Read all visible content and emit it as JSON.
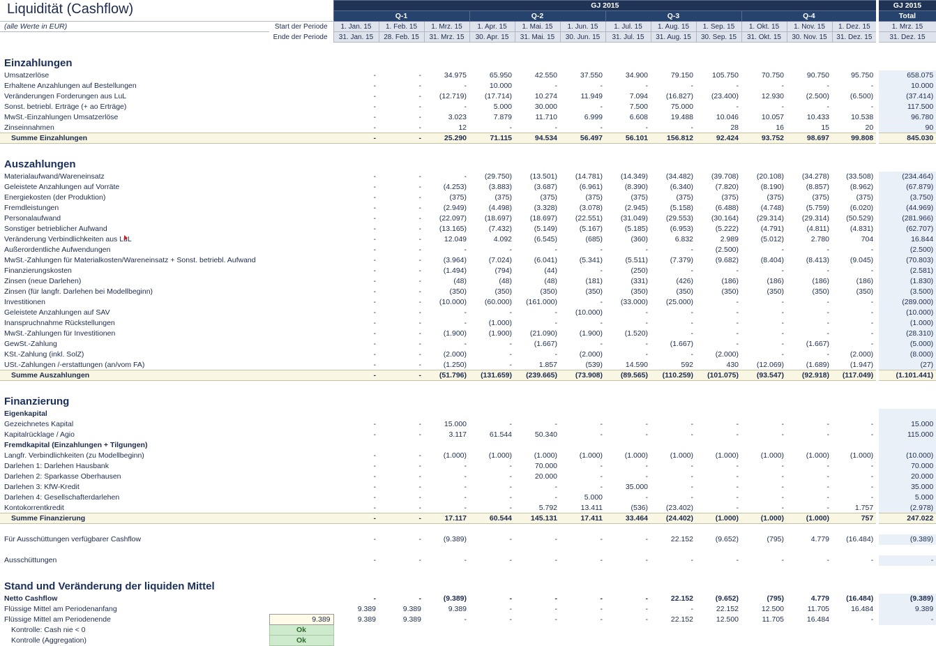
{
  "title": "Liquidität (Cashflow)",
  "subtitle": "(alle Werte in EUR)",
  "period_start_label": "Start der Periode",
  "period_end_label": "Ende der Periode",
  "header": {
    "year_main": "GJ 2015",
    "year_total": "GJ 2015",
    "total_sub": "Total",
    "quarters": [
      "Q-1",
      "Q-2",
      "Q-3",
      "Q-4"
    ],
    "months_start": [
      "1. Jan. 15",
      "1. Feb. 15",
      "1. Mrz. 15",
      "1. Apr. 15",
      "1. Mai. 15",
      "1. Jun. 15",
      "1. Jul. 15",
      "1. Aug. 15",
      "1. Sep. 15",
      "1. Okt. 15",
      "1. Nov. 15",
      "1. Dez. 15"
    ],
    "months_end": [
      "31. Jan. 15",
      "28. Feb. 15",
      "31. Mrz. 15",
      "30. Apr. 15",
      "31. Mai. 15",
      "30. Jun. 15",
      "31. Jul. 15",
      "31. Aug. 15",
      "30. Sep. 15",
      "31. Okt. 15",
      "30. Nov. 15",
      "31. Dez. 15"
    ],
    "total_start": "1. Mrz. 15",
    "total_end": "31. Dez. 15"
  },
  "sections": {
    "einz": "Einzahlungen",
    "ausz": "Auszahlungen",
    "fin": "Finanzierung",
    "stand": "Stand und Veränderung der liquiden Mittel"
  },
  "rows": {
    "umsatz": {
      "label": "Umsatzerlöse",
      "v": [
        "-",
        "-",
        "34.975",
        "65.950",
        "42.550",
        "37.550",
        "34.900",
        "79.150",
        "105.750",
        "70.750",
        "90.750",
        "95.750"
      ],
      "t": "658.075"
    },
    "anzahlungen": {
      "label": "Erhaltene Anzahlungen auf Bestellungen",
      "v": [
        "-",
        "-",
        "-",
        "10.000",
        "-",
        "-",
        "-",
        "-",
        "-",
        "-",
        "-",
        "-"
      ],
      "t": "10.000"
    },
    "fordlul": {
      "label": "Veränderungen Forderungen aus LuL",
      "v": [
        "-",
        "-",
        "(12.719)",
        "(17.714)",
        "10.274",
        "11.949",
        "7.094",
        "(16.827)",
        "(23.400)",
        "12.930",
        "(2.500)",
        "(6.500)"
      ],
      "t": "(37.414)"
    },
    "sonsterl": {
      "label": "Sonst. betriebl. Erträge (+ ao Erträge)",
      "v": [
        "-",
        "-",
        "-",
        "5.000",
        "30.000",
        "-",
        "7.500",
        "75.000",
        "-",
        "-",
        "-",
        "-"
      ],
      "t": "117.500"
    },
    "mwsteinz": {
      "label": "MwSt.-Einzahlungen Umsatzerlöse",
      "v": [
        "-",
        "-",
        "3.023",
        "7.879",
        "11.710",
        "6.999",
        "6.608",
        "19.488",
        "10.046",
        "10.057",
        "10.433",
        "10.538"
      ],
      "t": "96.780"
    },
    "zinsein": {
      "label": "Zinseinnahmen",
      "v": [
        "-",
        "-",
        "12",
        "-",
        "-",
        "-",
        "-",
        "-",
        "28",
        "16",
        "15",
        "20"
      ],
      "t": "90"
    },
    "sum_einz": {
      "label": "Summe Einzahlungen",
      "v": [
        "-",
        "-",
        "25.290",
        "71.115",
        "94.534",
        "56.497",
        "56.101",
        "156.812",
        "92.424",
        "93.752",
        "98.697",
        "99.808"
      ],
      "t": "845.030"
    },
    "material": {
      "label": "Materialaufwand/Wareneinsatz",
      "v": [
        "-",
        "-",
        "-",
        "(29.750)",
        "(13.501)",
        "(14.781)",
        "(14.349)",
        "(34.482)",
        "(39.708)",
        "(20.108)",
        "(34.278)",
        "(33.508)"
      ],
      "t": "(234.464)"
    },
    "gelanzvor": {
      "label": "Geleistete Anzahlungen auf Vorräte",
      "v": [
        "-",
        "-",
        "(4.253)",
        "(3.883)",
        "(3.687)",
        "(6.961)",
        "(8.390)",
        "(6.340)",
        "(7.820)",
        "(8.190)",
        "(8.857)",
        "(8.962)"
      ],
      "t": "(67.879)"
    },
    "energie": {
      "label": "Energiekosten (der Produktion)",
      "v": [
        "-",
        "-",
        "(375)",
        "(375)",
        "(375)",
        "(375)",
        "(375)",
        "(375)",
        "(375)",
        "(375)",
        "(375)",
        "(375)"
      ],
      "t": "(3.750)"
    },
    "fremdl": {
      "label": "Fremdleistungen",
      "v": [
        "-",
        "-",
        "(2.949)",
        "(4.498)",
        "(3.328)",
        "(3.078)",
        "(2.945)",
        "(5.158)",
        "(6.488)",
        "(4.748)",
        "(5.759)",
        "(6.020)"
      ],
      "t": "(44.969)"
    },
    "personal": {
      "label": "Personalaufwand",
      "v": [
        "-",
        "-",
        "(22.097)",
        "(18.697)",
        "(18.697)",
        "(22.551)",
        "(31.049)",
        "(29.553)",
        "(30.164)",
        "(29.314)",
        "(29.314)",
        "(50.529)"
      ],
      "t": "(281.966)"
    },
    "sonstaufw": {
      "label": "Sonstiger betrieblicher Aufwand",
      "v": [
        "-",
        "-",
        "(13.165)",
        "(7.432)",
        "(5.149)",
        "(5.167)",
        "(5.185)",
        "(6.953)",
        "(5.222)",
        "(4.791)",
        "(4.811)",
        "(4.831)"
      ],
      "t": "(62.707)"
    },
    "verblul": {
      "label": "Veränderung Verbindlichkeiten aus LuL",
      "v": [
        "-",
        "-",
        "12.049",
        "4.092",
        "(6.545)",
        "(685)",
        "(360)",
        "6.832",
        "2.989",
        "(5.012)",
        "2.780",
        "704"
      ],
      "t": "16.844"
    },
    "aoaufw": {
      "label": "Außerordentliche Aufwendungen",
      "v": [
        "-",
        "-",
        "-",
        "-",
        "-",
        "-",
        "-",
        "-",
        "(2.500)",
        "-",
        "-",
        "-"
      ],
      "t": "(2.500)"
    },
    "mwstzahl": {
      "label": "MwSt.-Zahlungen für Materialkosten/Wareneinsatz + Sonst. betriebl. Aufwand",
      "v": [
        "-",
        "-",
        "(3.964)",
        "(7.024)",
        "(6.041)",
        "(5.341)",
        "(5.511)",
        "(7.379)",
        "(9.682)",
        "(8.404)",
        "(8.413)",
        "(9.045)"
      ],
      "t": "(70.803)"
    },
    "finkost": {
      "label": "Finanzierungskosten",
      "v": [
        "-",
        "-",
        "(1.494)",
        "(794)",
        "(44)",
        "-",
        "(250)",
        "-",
        "-",
        "-",
        "-",
        "-"
      ],
      "t": "(2.581)"
    },
    "zinsneu": {
      "label": "Zinsen (neue Darlehen)",
      "v": [
        "-",
        "-",
        "(48)",
        "(48)",
        "(48)",
        "(181)",
        "(331)",
        "(426)",
        "(186)",
        "(186)",
        "(186)",
        "(186)"
      ],
      "t": "(1.830)"
    },
    "zinslangfr": {
      "label": "Zinsen (für langfr. Darlehen bei Modellbeginn)",
      "v": [
        "-",
        "-",
        "(350)",
        "(350)",
        "(350)",
        "(350)",
        "(350)",
        "(350)",
        "(350)",
        "(350)",
        "(350)",
        "(350)"
      ],
      "t": "(3.500)"
    },
    "invest": {
      "label": "Investitionen",
      "v": [
        "-",
        "-",
        "(10.000)",
        "(60.000)",
        "(161.000)",
        "-",
        "(33.000)",
        "(25.000)",
        "-",
        "-",
        "-",
        "-"
      ],
      "t": "(289.000)"
    },
    "anzsa": {
      "label": "Geleistete Anzahlungen auf SAV",
      "v": [
        "-",
        "-",
        "-",
        "-",
        "-",
        "(10.000)",
        "-",
        "-",
        "-",
        "-",
        "-",
        "-"
      ],
      "t": "(10.000)"
    },
    "rueckst": {
      "label": "Inanspruchnahme Rückstellungen",
      "v": [
        "-",
        "-",
        "-",
        "(1.000)",
        "-",
        "-",
        "-",
        "-",
        "-",
        "-",
        "-",
        "-"
      ],
      "t": "(1.000)"
    },
    "mwstinv": {
      "label": "MwSt.-Zahlungen für Investitionen",
      "v": [
        "-",
        "-",
        "(1.900)",
        "(1.900)",
        "(21.090)",
        "(1.900)",
        "(1.520)",
        "-",
        "-",
        "-",
        "-",
        "-"
      ],
      "t": "(28.310)"
    },
    "gewst": {
      "label": "GewSt.-Zahlung",
      "v": [
        "-",
        "-",
        "-",
        "-",
        "(1.667)",
        "-",
        "-",
        "(1.667)",
        "-",
        "-",
        "(1.667)",
        "-"
      ],
      "t": "(5.000)"
    },
    "kst": {
      "label": "KSt.-Zahlung (inkl. SolZ)",
      "v": [
        "-",
        "-",
        "(2.000)",
        "-",
        "-",
        "(2.000)",
        "-",
        "-",
        "(2.000)",
        "-",
        "-",
        "(2.000)"
      ],
      "t": "(8.000)"
    },
    "ustfa": {
      "label": "USt.-Zahlungen /-erstattungen (an/vom FA)",
      "v": [
        "-",
        "-",
        "(1.250)",
        "-",
        "1.857",
        "(539)",
        "14.590",
        "592",
        "430",
        "(12.069)",
        "(1.689)",
        "(1.947)"
      ],
      "t": "(27)"
    },
    "sum_ausz": {
      "label": "Summe Auszahlungen",
      "v": [
        "-",
        "-",
        "(51.796)",
        "(131.659)",
        "(239.665)",
        "(73.908)",
        "(89.565)",
        "(110.259)",
        "(101.075)",
        "(93.547)",
        "(92.918)",
        "(117.049)"
      ],
      "t": "(1.101.441)"
    },
    "eigenk": {
      "label": "Eigenkapital"
    },
    "gezkap": {
      "label": "Gezeichnetes Kapital",
      "v": [
        "-",
        "-",
        "15.000",
        "-",
        "-",
        "-",
        "-",
        "-",
        "-",
        "-",
        "-",
        "-"
      ],
      "t": "15.000"
    },
    "kapruck": {
      "label": "Kapitalrücklage / Agio",
      "v": [
        "-",
        "-",
        "3.117",
        "61.544",
        "50.340",
        "-",
        "-",
        "-",
        "-",
        "-",
        "-",
        "-"
      ],
      "t": "115.000"
    },
    "fremdk": {
      "label": "Fremdkapital (Einzahlungen + Tilgungen)"
    },
    "langfrverb": {
      "label": "Langfr. Verbindlichkeiten (zu Modellbeginn)",
      "v": [
        "-",
        "-",
        "(1.000)",
        "(1.000)",
        "(1.000)",
        "(1.000)",
        "(1.000)",
        "(1.000)",
        "(1.000)",
        "(1.000)",
        "(1.000)",
        "(1.000)"
      ],
      "t": "(10.000)"
    },
    "darl1": {
      "label": "Darlehen 1: Darlehen Hausbank",
      "v": [
        "-",
        "-",
        "-",
        "-",
        "70.000",
        "-",
        "-",
        "-",
        "-",
        "-",
        "-",
        "-"
      ],
      "t": "70.000"
    },
    "darl2": {
      "label": "Darlehen 2: Sparkasse Oberhausen",
      "v": [
        "-",
        "-",
        "-",
        "-",
        "20.000",
        "-",
        "-",
        "-",
        "-",
        "-",
        "-",
        "-"
      ],
      "t": "20.000"
    },
    "darl3": {
      "label": "Darlehen 3: KfW-Kredit",
      "v": [
        "-",
        "-",
        "-",
        "-",
        "-",
        "-",
        "35.000",
        "-",
        "-",
        "-",
        "-",
        "-"
      ],
      "t": "35.000"
    },
    "darl4": {
      "label": "Darlehen 4: Gesellschafterdarlehen",
      "v": [
        "-",
        "-",
        "-",
        "-",
        "-",
        "5.000",
        "-",
        "-",
        "-",
        "-",
        "-",
        "-"
      ],
      "t": "5.000"
    },
    "kontokorr": {
      "label": "Kontokorrentkredit",
      "v": [
        "-",
        "-",
        "-",
        "-",
        "5.792",
        "13.411",
        "(536)",
        "(23.402)",
        "-",
        "-",
        "-",
        "1.757"
      ],
      "t": "(2.978)"
    },
    "sum_fin": {
      "label": "Summe Finanzierung",
      "v": [
        "-",
        "-",
        "17.117",
        "60.544",
        "145.131",
        "17.411",
        "33.464",
        "(24.402)",
        "(1.000)",
        "(1.000)",
        "(1.000)",
        "757"
      ],
      "t": "247.022"
    },
    "verfcf": {
      "label": "Für Ausschüttungen verfügbarer Cashflow",
      "v": [
        "-",
        "-",
        "(9.389)",
        "-",
        "-",
        "-",
        "-",
        "22.152",
        "(9.652)",
        "(795)",
        "4.779",
        "(16.484)"
      ],
      "t": "(9.389)"
    },
    "aussch": {
      "label": "Ausschüttungen",
      "v": [
        "-",
        "-",
        "-",
        "-",
        "-",
        "-",
        "-",
        "-",
        "-",
        "-",
        "-",
        "-"
      ],
      "t": "-"
    },
    "nettocf": {
      "label": "Netto Cashflow",
      "v": [
        "-",
        "-",
        "(9.389)",
        "-",
        "-",
        "-",
        "-",
        "22.152",
        "(9.652)",
        "(795)",
        "4.779",
        "(16.484)"
      ],
      "t": "(9.389)"
    },
    "flpa": {
      "label": "Flüssige Mittel am Periodenanfang",
      "v": [
        "9.389",
        "9.389",
        "9.389",
        "-",
        "-",
        "-",
        "-",
        "-",
        "22.152",
        "12.500",
        "11.705",
        "16.484"
      ],
      "t": "9.389"
    },
    "flpe": {
      "label": "Flüssige Mittel am Periodenende",
      "v": [
        "9.389",
        "9.389",
        "-",
        "-",
        "-",
        "-",
        "-",
        "22.152",
        "12.500",
        "11.705",
        "16.484",
        "-"
      ],
      "t": "-"
    },
    "flpe_box": "9.389",
    "k_cash": {
      "label": "Kontrolle: Cash nie < 0",
      "ok": "Ok"
    },
    "k_aggr": {
      "label": "Kontrolle (Aggregation)",
      "ok": "Ok"
    }
  }
}
